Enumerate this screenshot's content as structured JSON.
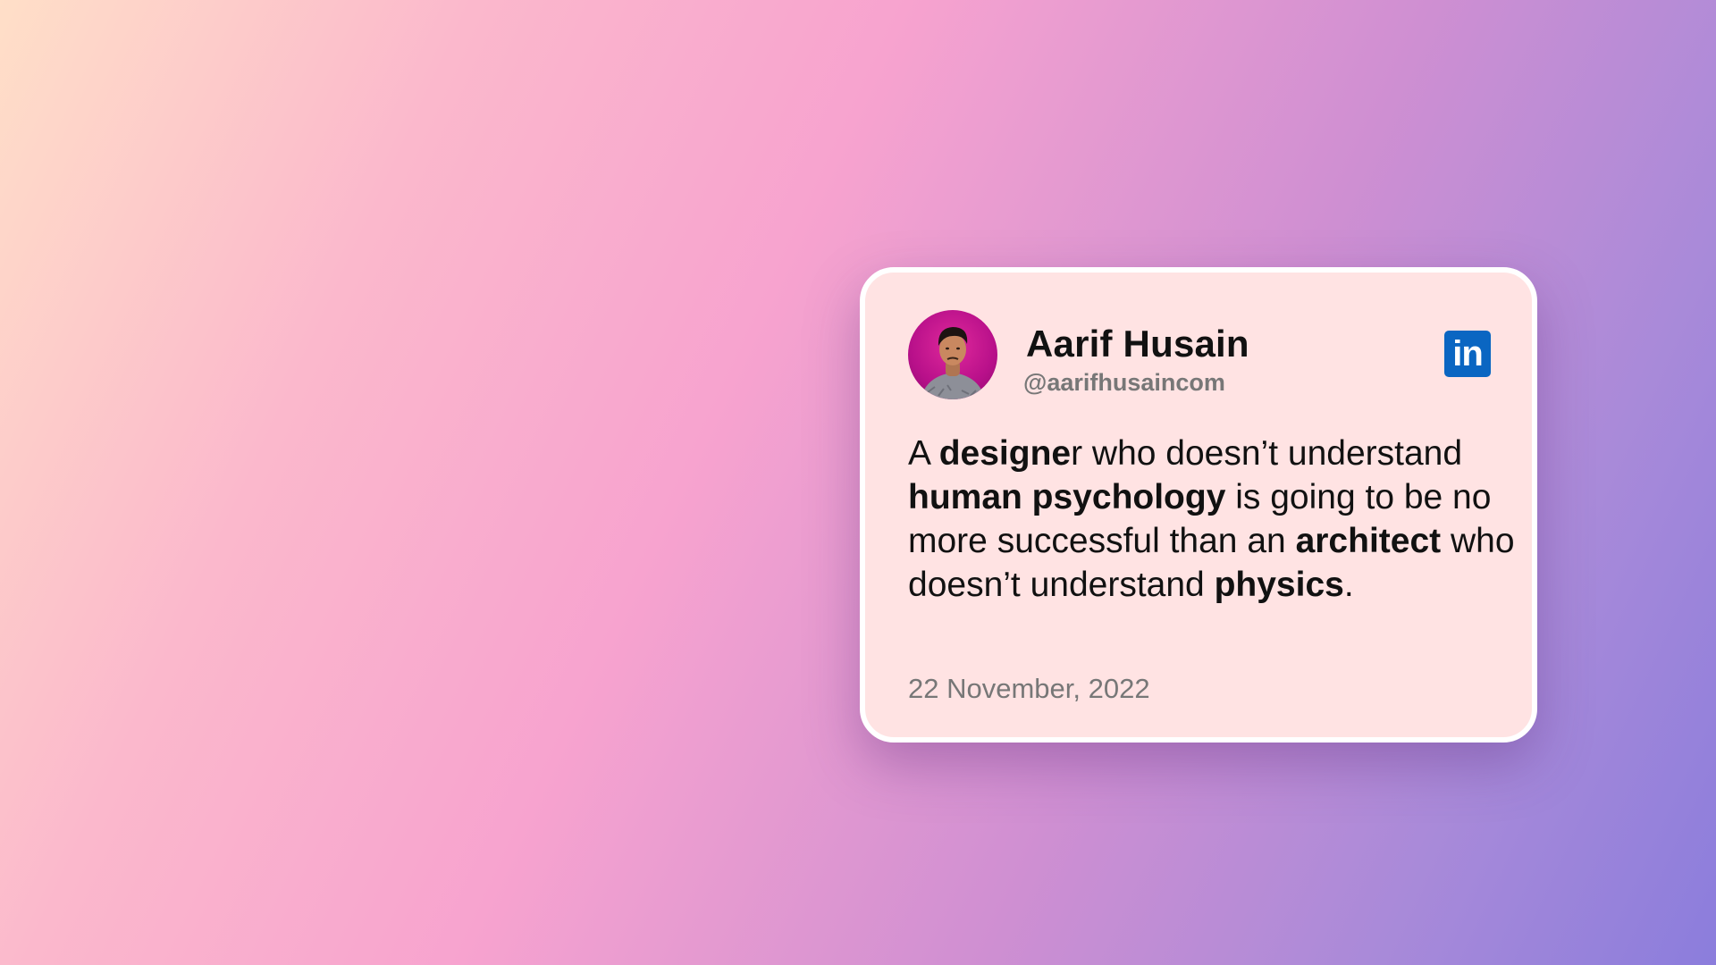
{
  "author": {
    "name": "Aarif Husain",
    "handle": "@aarifhusaincom",
    "avatar_icon": "person-photo-avatar"
  },
  "platform": {
    "name": "LinkedIn",
    "logo_text": "in",
    "icon": "linkedin-icon",
    "color": "#0a66c2"
  },
  "post": {
    "segments": [
      {
        "text": "A ",
        "bold": false
      },
      {
        "text": "designe",
        "bold": true
      },
      {
        "text": "r who doesn’t understand ",
        "bold": false
      },
      {
        "text": "human psychology",
        "bold": true
      },
      {
        "text": " is going to be no more successful than an ",
        "bold": false
      },
      {
        "text": "architect",
        "bold": true
      },
      {
        "text": " who doesn’t understand ",
        "bold": false
      },
      {
        "text": "physics",
        "bold": true
      },
      {
        "text": ".",
        "bold": false
      }
    ],
    "date": "22 November, 2022"
  },
  "colors": {
    "card_background": "#ffe3e3",
    "card_border": "#ffffff",
    "avatar_ring": "#c2168f",
    "muted_text": "#777777"
  }
}
